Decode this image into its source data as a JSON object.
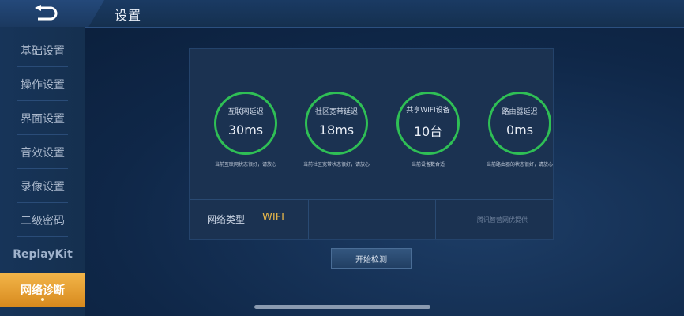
{
  "header": {
    "title": "设置"
  },
  "sidebar": {
    "items": [
      {
        "label": "基础设置"
      },
      {
        "label": "操作设置"
      },
      {
        "label": "界面设置"
      },
      {
        "label": "音效设置"
      },
      {
        "label": "录像设置"
      },
      {
        "label": "二级密码"
      },
      {
        "label": "ReplayKit"
      },
      {
        "label": "网络诊断"
      }
    ],
    "active_index": 7
  },
  "metrics": [
    {
      "label": "互联网延迟",
      "value": "30ms",
      "desc": "当前互联网状态很好，请放心"
    },
    {
      "label": "社区宽带延迟",
      "value": "18ms",
      "desc": "当前社区宽带状态很好，请放心"
    },
    {
      "label": "共享WIFI设备",
      "value": "10台",
      "desc": "当前设备数合适"
    },
    {
      "label": "路由器延迟",
      "value": "0ms",
      "desc": "当前路由器的状态很好，请放心"
    }
  ],
  "network": {
    "type_label": "网络类型",
    "type_value": "WIFI",
    "provider": "腾讯智营网优提供"
  },
  "actions": {
    "check_label": "开始检测"
  },
  "colors": {
    "accent": "#2fbf55",
    "active_tab": "#e9a334",
    "wifi": "#e6b64a"
  }
}
